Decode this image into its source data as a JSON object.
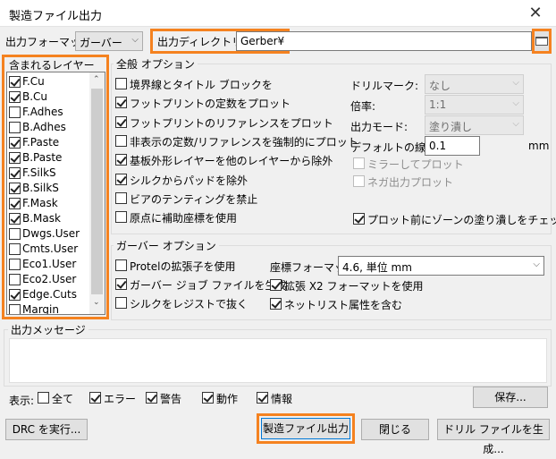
{
  "window": {
    "title": "製造ファイル出力",
    "close_glyph": "✕"
  },
  "output_format": {
    "label": "出力フォーマット:",
    "value": "ガーバー"
  },
  "output_dir": {
    "label": "出力ディレクトリー:",
    "value": "Gerber¥"
  },
  "layers": {
    "title": "含まれるレイヤー",
    "items": [
      {
        "name": "F.Cu",
        "checked": true
      },
      {
        "name": "B.Cu",
        "checked": true
      },
      {
        "name": "F.Adhes",
        "checked": false
      },
      {
        "name": "B.Adhes",
        "checked": false
      },
      {
        "name": "F.Paste",
        "checked": true
      },
      {
        "name": "B.Paste",
        "checked": true
      },
      {
        "name": "F.SilkS",
        "checked": true
      },
      {
        "name": "B.SilkS",
        "checked": true
      },
      {
        "name": "F.Mask",
        "checked": true
      },
      {
        "name": "B.Mask",
        "checked": true
      },
      {
        "name": "Dwgs.User",
        "checked": false
      },
      {
        "name": "Cmts.User",
        "checked": false
      },
      {
        "name": "Eco1.User",
        "checked": false
      },
      {
        "name": "Eco2.User",
        "checked": false
      },
      {
        "name": "Edge.Cuts",
        "checked": true
      },
      {
        "name": "Margin",
        "checked": false
      }
    ]
  },
  "general": {
    "title": "全般 オプション",
    "options": [
      {
        "label": "境界線とタイトル ブロックを",
        "checked": false
      },
      {
        "label": "フットプリントの定数をプロット",
        "checked": true
      },
      {
        "label": "フットプリントのリファレンスをプロット",
        "checked": true
      },
      {
        "label": "非表示の定数/リファレンスを強制的にプロット",
        "checked": false
      },
      {
        "label": "基板外形レイヤーを他のレイヤーから除外",
        "checked": true
      },
      {
        "label": "シルクからパッドを除外",
        "checked": true
      },
      {
        "label": "ビアのテンティングを禁止",
        "checked": false
      },
      {
        "label": "原点に補助座標を使用",
        "checked": false
      }
    ],
    "drill_mark": {
      "label": "ドリルマーク:",
      "value": "なし"
    },
    "scale": {
      "label": "倍率:",
      "value": "1:1"
    },
    "output_mode": {
      "label": "出力モード:",
      "value": "塗り潰し"
    },
    "line_width": {
      "label": "デフォルトの線幅:",
      "value": "0.1",
      "unit": "mm"
    },
    "mirror": {
      "label": "ミラーしてプロット",
      "checked": false
    },
    "negative": {
      "label": "ネガ出力プロット",
      "checked": false
    },
    "zone_fill": {
      "label": "プロット前にゾーンの塗り潰しをチェック",
      "checked": true
    }
  },
  "gerber": {
    "title": "ガーバー オプション",
    "options": [
      {
        "label": "Protelの拡張子を使用",
        "checked": false
      },
      {
        "label": "ガーバー ジョブ ファイルを生成",
        "checked": true
      },
      {
        "label": "シルクをレジストで抜く",
        "checked": false
      }
    ],
    "coord_format": {
      "label": "座標フォーマット:",
      "value": "4.6, 単位 mm"
    },
    "x2_format": {
      "label": "拡張 X2 フォーマットを使用",
      "checked": true
    },
    "netlist_attr": {
      "label": "ネットリスト属性を含む",
      "checked": true
    }
  },
  "messages": {
    "title": "出力メッセージ",
    "show_label": "表示:",
    "filters": [
      {
        "label": "全て",
        "checked": false
      },
      {
        "label": "エラー",
        "checked": true
      },
      {
        "label": "警告",
        "checked": true
      },
      {
        "label": "動作",
        "checked": true
      },
      {
        "label": "情報",
        "checked": true
      }
    ],
    "save_button": "保存..."
  },
  "footer": {
    "drc_button": "DRC を実行...",
    "plot_button": "製造ファイル出力",
    "close_button": "閉じる",
    "drill_button": "ドリル ファイルを生成..."
  },
  "colors": {
    "highlight": "#f58220",
    "accent": "#0078d7"
  }
}
